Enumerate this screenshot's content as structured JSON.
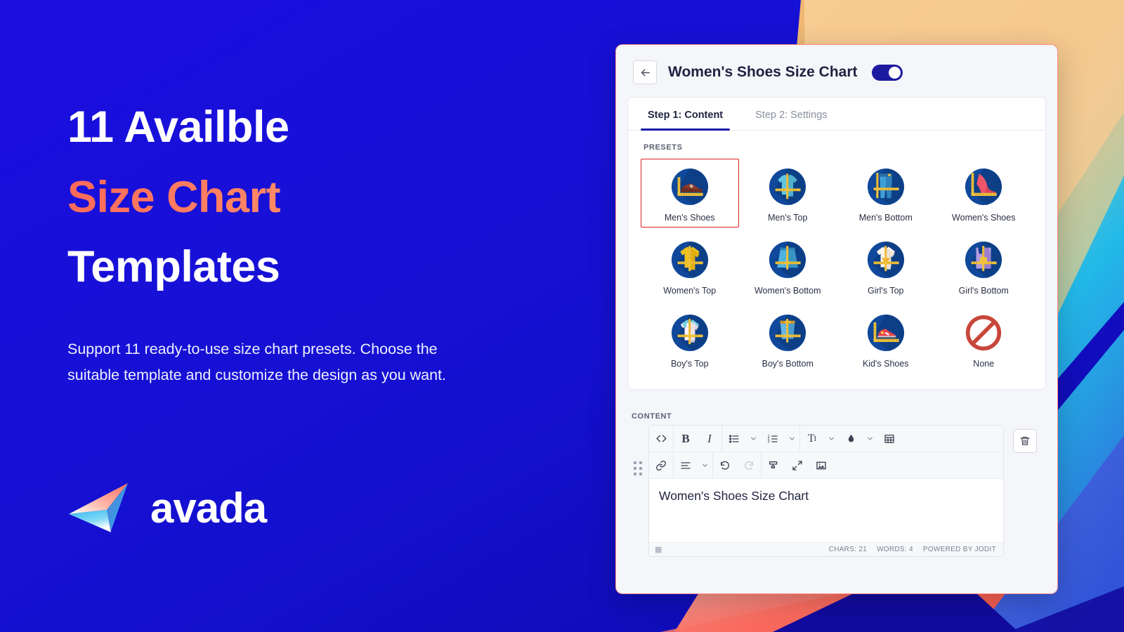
{
  "promo": {
    "headline_line1": "11 Availble",
    "headline_line2": "Size Chart",
    "headline_line3": "Templates",
    "body": "Support 11 ready-to-use size chart presets. Choose the suitable template and customize the design as you want.",
    "brand": "avada",
    "accent_gradient_from": "#ff6a5a",
    "accent_gradient_to": "#fcc98a",
    "background_color": "#1410d8"
  },
  "panel": {
    "title": "Women's Shoes Size Chart",
    "back_icon": "arrow-left-icon",
    "enabled": true,
    "accent_color": "#1a1aa8",
    "selected_outline_color": "#e02020"
  },
  "tabs": [
    {
      "label": "Step 1: Content",
      "active": true
    },
    {
      "label": "Step 2: Settings",
      "active": false
    }
  ],
  "presets": {
    "section_label": "PRESETS",
    "items": [
      {
        "label": "Men's Shoes",
        "icon": "mens-shoe-icon",
        "selected": true
      },
      {
        "label": "Men's Top",
        "icon": "mens-shirt-icon",
        "selected": false
      },
      {
        "label": "Men's Bottom",
        "icon": "mens-jeans-icon",
        "selected": false
      },
      {
        "label": "Women's Shoes",
        "icon": "high-heel-icon",
        "selected": false
      },
      {
        "label": "Women's Top",
        "icon": "womens-tshirt-icon",
        "selected": false
      },
      {
        "label": "Women's Bottom",
        "icon": "womens-skirt-icon",
        "selected": false
      },
      {
        "label": "Girl's Top",
        "icon": "girls-tshirt-icon",
        "selected": false
      },
      {
        "label": "Girl's Bottom",
        "icon": "girls-overall-icon",
        "selected": false
      },
      {
        "label": "Boy's Top",
        "icon": "boys-tshirt-icon",
        "selected": false
      },
      {
        "label": "Boy's Bottom",
        "icon": "boys-shorts-icon",
        "selected": false
      },
      {
        "label": "Kid's Shoes",
        "icon": "kids-sneaker-icon",
        "selected": false
      },
      {
        "label": "None",
        "icon": "prohibition-icon",
        "selected": false
      }
    ]
  },
  "content": {
    "section_label": "CONTENT",
    "editor_text": "Women's Shoes Size Chart",
    "drag_handle_icon": "drag-dots-icon",
    "delete_icon": "trash-icon",
    "status": {
      "chars": "CHARS: 21",
      "words": "WORDS: 4",
      "powered": "POWERED BY JODIT",
      "resize_icon": "resize-grip-icon"
    },
    "toolbar_row1": [
      {
        "icon": "source-code-icon",
        "glyph": "code",
        "caret": false,
        "disabled": false
      },
      {
        "icon": "bold-icon",
        "glyph": "bold",
        "caret": false,
        "disabled": false
      },
      {
        "icon": "italic-icon",
        "glyph": "italic",
        "caret": false,
        "disabled": false
      },
      {
        "icon": "unordered-list-icon",
        "glyph": "ul",
        "caret": true,
        "disabled": false
      },
      {
        "icon": "ordered-list-icon",
        "glyph": "ol",
        "caret": true,
        "disabled": false
      },
      {
        "icon": "font-size-icon",
        "glyph": "tt",
        "caret": true,
        "disabled": false
      },
      {
        "icon": "text-color-icon",
        "glyph": "drop",
        "caret": true,
        "disabled": false
      },
      {
        "icon": "table-icon",
        "glyph": "table",
        "caret": false,
        "disabled": false
      }
    ],
    "toolbar_row2": [
      {
        "icon": "link-icon",
        "glyph": "link",
        "caret": false,
        "disabled": false
      },
      {
        "icon": "align-icon",
        "glyph": "align",
        "caret": true,
        "disabled": false
      },
      {
        "icon": "undo-icon",
        "glyph": "undo",
        "caret": false,
        "disabled": false
      },
      {
        "icon": "redo-icon",
        "glyph": "redo",
        "caret": false,
        "disabled": true
      },
      {
        "icon": "eraser-icon",
        "glyph": "eraser",
        "caret": false,
        "disabled": false
      },
      {
        "icon": "fullscreen-icon",
        "glyph": "fs",
        "caret": false,
        "disabled": false
      },
      {
        "icon": "image-icon",
        "glyph": "image",
        "caret": false,
        "disabled": false
      }
    ]
  }
}
